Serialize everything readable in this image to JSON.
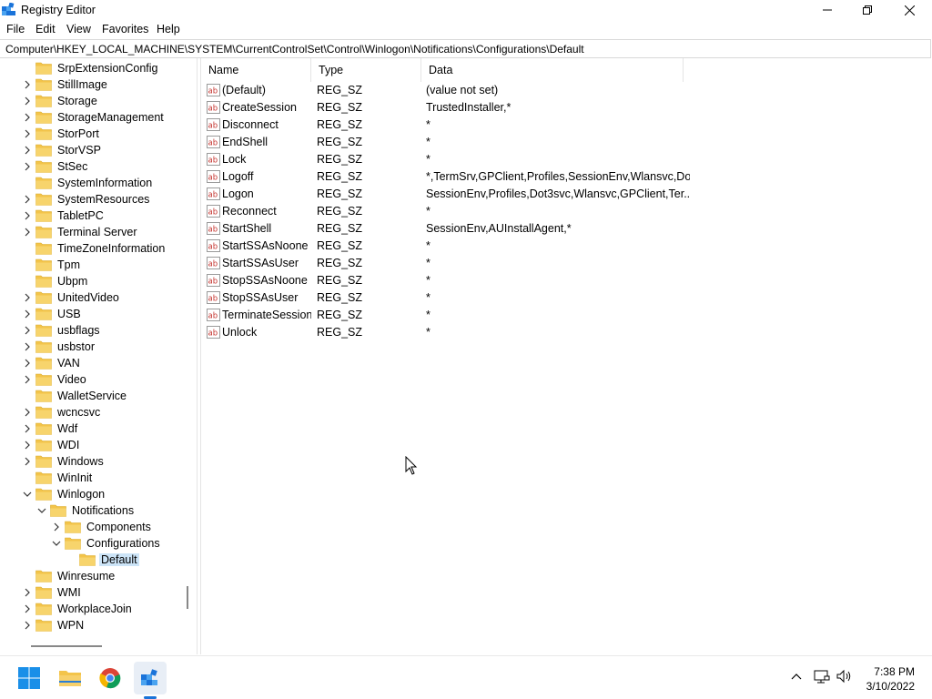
{
  "window": {
    "title": "Registry Editor"
  },
  "menu": [
    "File",
    "Edit",
    "View",
    "Favorites",
    "Help"
  ],
  "address": "Computer\\HKEY_LOCAL_MACHINE\\SYSTEM\\CurrentControlSet\\Control\\Winlogon\\Notifications\\Configurations\\Default",
  "tree": [
    {
      "label": "SrpExtensionConfig",
      "depth": 0,
      "chevron": "none"
    },
    {
      "label": "StillImage",
      "depth": 0,
      "chevron": "right"
    },
    {
      "label": "Storage",
      "depth": 0,
      "chevron": "right"
    },
    {
      "label": "StorageManagement",
      "depth": 0,
      "chevron": "right"
    },
    {
      "label": "StorPort",
      "depth": 0,
      "chevron": "right"
    },
    {
      "label": "StorVSP",
      "depth": 0,
      "chevron": "right"
    },
    {
      "label": "StSec",
      "depth": 0,
      "chevron": "right"
    },
    {
      "label": "SystemInformation",
      "depth": 0,
      "chevron": "none"
    },
    {
      "label": "SystemResources",
      "depth": 0,
      "chevron": "right"
    },
    {
      "label": "TabletPC",
      "depth": 0,
      "chevron": "right"
    },
    {
      "label": "Terminal Server",
      "depth": 0,
      "chevron": "right"
    },
    {
      "label": "TimeZoneInformation",
      "depth": 0,
      "chevron": "none"
    },
    {
      "label": "Tpm",
      "depth": 0,
      "chevron": "none"
    },
    {
      "label": "Ubpm",
      "depth": 0,
      "chevron": "none"
    },
    {
      "label": "UnitedVideo",
      "depth": 0,
      "chevron": "right"
    },
    {
      "label": "USB",
      "depth": 0,
      "chevron": "right"
    },
    {
      "label": "usbflags",
      "depth": 0,
      "chevron": "right"
    },
    {
      "label": "usbstor",
      "depth": 0,
      "chevron": "right"
    },
    {
      "label": "VAN",
      "depth": 0,
      "chevron": "right"
    },
    {
      "label": "Video",
      "depth": 0,
      "chevron": "right"
    },
    {
      "label": "WalletService",
      "depth": 0,
      "chevron": "none"
    },
    {
      "label": "wcncsvc",
      "depth": 0,
      "chevron": "right"
    },
    {
      "label": "Wdf",
      "depth": 0,
      "chevron": "right"
    },
    {
      "label": "WDI",
      "depth": 0,
      "chevron": "right"
    },
    {
      "label": "Windows",
      "depth": 0,
      "chevron": "right"
    },
    {
      "label": "WinInit",
      "depth": 0,
      "chevron": "none"
    },
    {
      "label": "Winlogon",
      "depth": 0,
      "chevron": "down"
    },
    {
      "label": "Notifications",
      "depth": 1,
      "chevron": "down"
    },
    {
      "label": "Components",
      "depth": 2,
      "chevron": "right"
    },
    {
      "label": "Configurations",
      "depth": 2,
      "chevron": "down"
    },
    {
      "label": "Default",
      "depth": 3,
      "chevron": "none",
      "selected": true
    },
    {
      "label": "Winresume",
      "depth": 0,
      "chevron": "none"
    },
    {
      "label": "WMI",
      "depth": 0,
      "chevron": "right"
    },
    {
      "label": "WorkplaceJoin",
      "depth": 0,
      "chevron": "right"
    },
    {
      "label": "WPN",
      "depth": 0,
      "chevron": "right"
    }
  ],
  "list": {
    "columns": [
      "Name",
      "Type",
      "Data"
    ],
    "rows": [
      {
        "name": "(Default)",
        "type": "REG_SZ",
        "data": "(value not set)"
      },
      {
        "name": "CreateSession",
        "type": "REG_SZ",
        "data": "TrustedInstaller,*"
      },
      {
        "name": "Disconnect",
        "type": "REG_SZ",
        "data": "*"
      },
      {
        "name": "EndShell",
        "type": "REG_SZ",
        "data": "*"
      },
      {
        "name": "Lock",
        "type": "REG_SZ",
        "data": "*"
      },
      {
        "name": "Logoff",
        "type": "REG_SZ",
        "data": "*,TermSrv,GPClient,Profiles,SessionEnv,Wlansvc,Do..."
      },
      {
        "name": "Logon",
        "type": "REG_SZ",
        "data": "SessionEnv,Profiles,Dot3svc,Wlansvc,GPClient,Ter..."
      },
      {
        "name": "Reconnect",
        "type": "REG_SZ",
        "data": "*"
      },
      {
        "name": "StartShell",
        "type": "REG_SZ",
        "data": "SessionEnv,AUInstallAgent,*"
      },
      {
        "name": "StartSSAsNoone",
        "type": "REG_SZ",
        "data": "*"
      },
      {
        "name": "StartSSAsUser",
        "type": "REG_SZ",
        "data": "*"
      },
      {
        "name": "StopSSAsNoone",
        "type": "REG_SZ",
        "data": "*"
      },
      {
        "name": "StopSSAsUser",
        "type": "REG_SZ",
        "data": "*"
      },
      {
        "name": "TerminateSession",
        "type": "REG_SZ",
        "data": "*"
      },
      {
        "name": "Unlock",
        "type": "REG_SZ",
        "data": "*"
      }
    ]
  },
  "taskbar": {
    "apps": [
      "windows-start-icon",
      "file-explorer-icon",
      "chrome-icon",
      "registry-editor-icon"
    ],
    "time": "7:38 PM",
    "date": "3/10/2022"
  },
  "colors": {
    "folder": "#f3c44a",
    "selection": "#cce4f7",
    "accent": "#1a73d9"
  }
}
